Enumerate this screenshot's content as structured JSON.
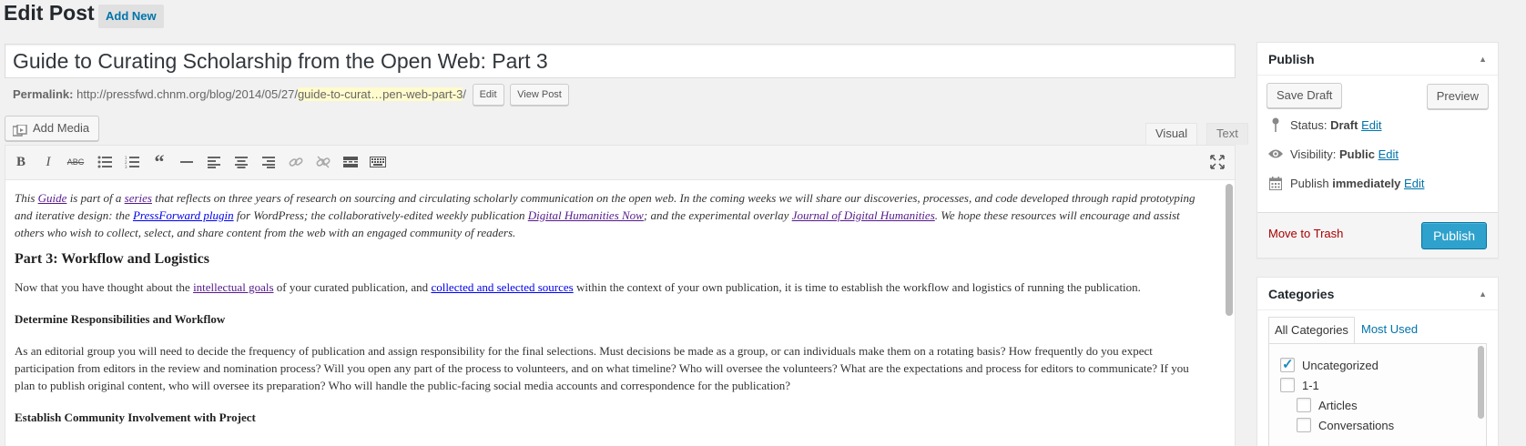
{
  "header": {
    "title": "Edit Post",
    "add_new_label": "Add New"
  },
  "post": {
    "title": "Guide to Curating Scholarship from the Open Web: Part 3",
    "permalink_label": "Permalink:",
    "permalink_base": "http://pressfwd.chnm.org/blog/2014/05/27/",
    "permalink_slug": "guide-to-curat…pen-web-part-3",
    "permalink_trail": "/",
    "edit_label": "Edit",
    "view_label": "View Post"
  },
  "editor": {
    "add_media_label": "Add Media",
    "tab_visual": "Visual",
    "tab_text": "Text",
    "toolbar_icons": [
      "bold-icon",
      "italic-icon",
      "strikethrough-icon",
      "bullet-list-icon",
      "numbered-list-icon",
      "blockquote-icon",
      "horizontal-rule-icon",
      "align-left-icon",
      "align-center-icon",
      "align-right-icon",
      "insert-link-icon",
      "remove-link-icon",
      "read-more-icon",
      "toolbar-toggle-icon",
      "fullscreen-icon"
    ],
    "intro": {
      "t1": "This ",
      "l1": "Guide",
      "t2": " is part of a ",
      "l2": "series",
      "t3": " that reflects on three years of research on sourcing and circulating scholarly communication on the open web. In the coming weeks we will share our discoveries, processes, and code developed through rapid prototyping and iterative design: the ",
      "l3": "PressForward plugin",
      "t4": " for WordPress; the collaboratively-edited weekly publication ",
      "l4": "Digital Humanities Now",
      "t5": "; and the experimental overlay ",
      "l5": "Journal of Digital Humanities",
      "t6": ". We hope these resources will encourage and assist others who wish to collect, select, and share content from the web with an engaged community of readers."
    },
    "heading": "Part 3: Workflow and Logistics",
    "para1": {
      "t1": "Now that you have thought about the ",
      "l1": "intellectual goals",
      "t2": " of your curated publication, and ",
      "l2": "collected and selected sources",
      "t3": " within the context of your own publication, it is time to establish the workflow and logistics of running the publication."
    },
    "subheading1": "Determine Responsibilities and Workflow",
    "para2": "As an editorial group you will need to decide the frequency of publication and assign responsibility for the final selections. Must decisions be made as a group, or can individuals make them on a rotating basis? How frequently do you expect participation from editors in the review and nomination process? Will you open any part of the process to volunteers, and on what timeline? Who will oversee the volunteers? What are the expectations and process for editors to communicate? If you plan to publish original content, who will oversee its preparation? Who will handle the public-facing social media accounts and correspondence for the publication?",
    "subheading2": "Establish Community Involvement with Project"
  },
  "publish": {
    "title": "Publish",
    "save_draft": "Save Draft",
    "preview": "Preview",
    "status_label": "Status:",
    "status_value": "Draft",
    "visibility_label": "Visibility:",
    "visibility_value": "Public",
    "publish_label": "Publish",
    "publish_value": "immediately",
    "edit": "Edit",
    "move_to_trash": "Move to Trash",
    "publish_button": "Publish"
  },
  "categories": {
    "title": "Categories",
    "tab_all": "All Categories",
    "tab_most_used": "Most Used",
    "items": [
      {
        "label": "Uncategorized",
        "checked": true
      },
      {
        "label": "1-1",
        "checked": false
      },
      {
        "label": "Articles",
        "checked": false
      },
      {
        "label": "Conversations",
        "checked": false
      }
    ]
  },
  "colors": {
    "accent": "#0073aa",
    "publish_button": "#2ea2cc",
    "trash": "#a00",
    "slug_highlight": "#fffbcc"
  }
}
